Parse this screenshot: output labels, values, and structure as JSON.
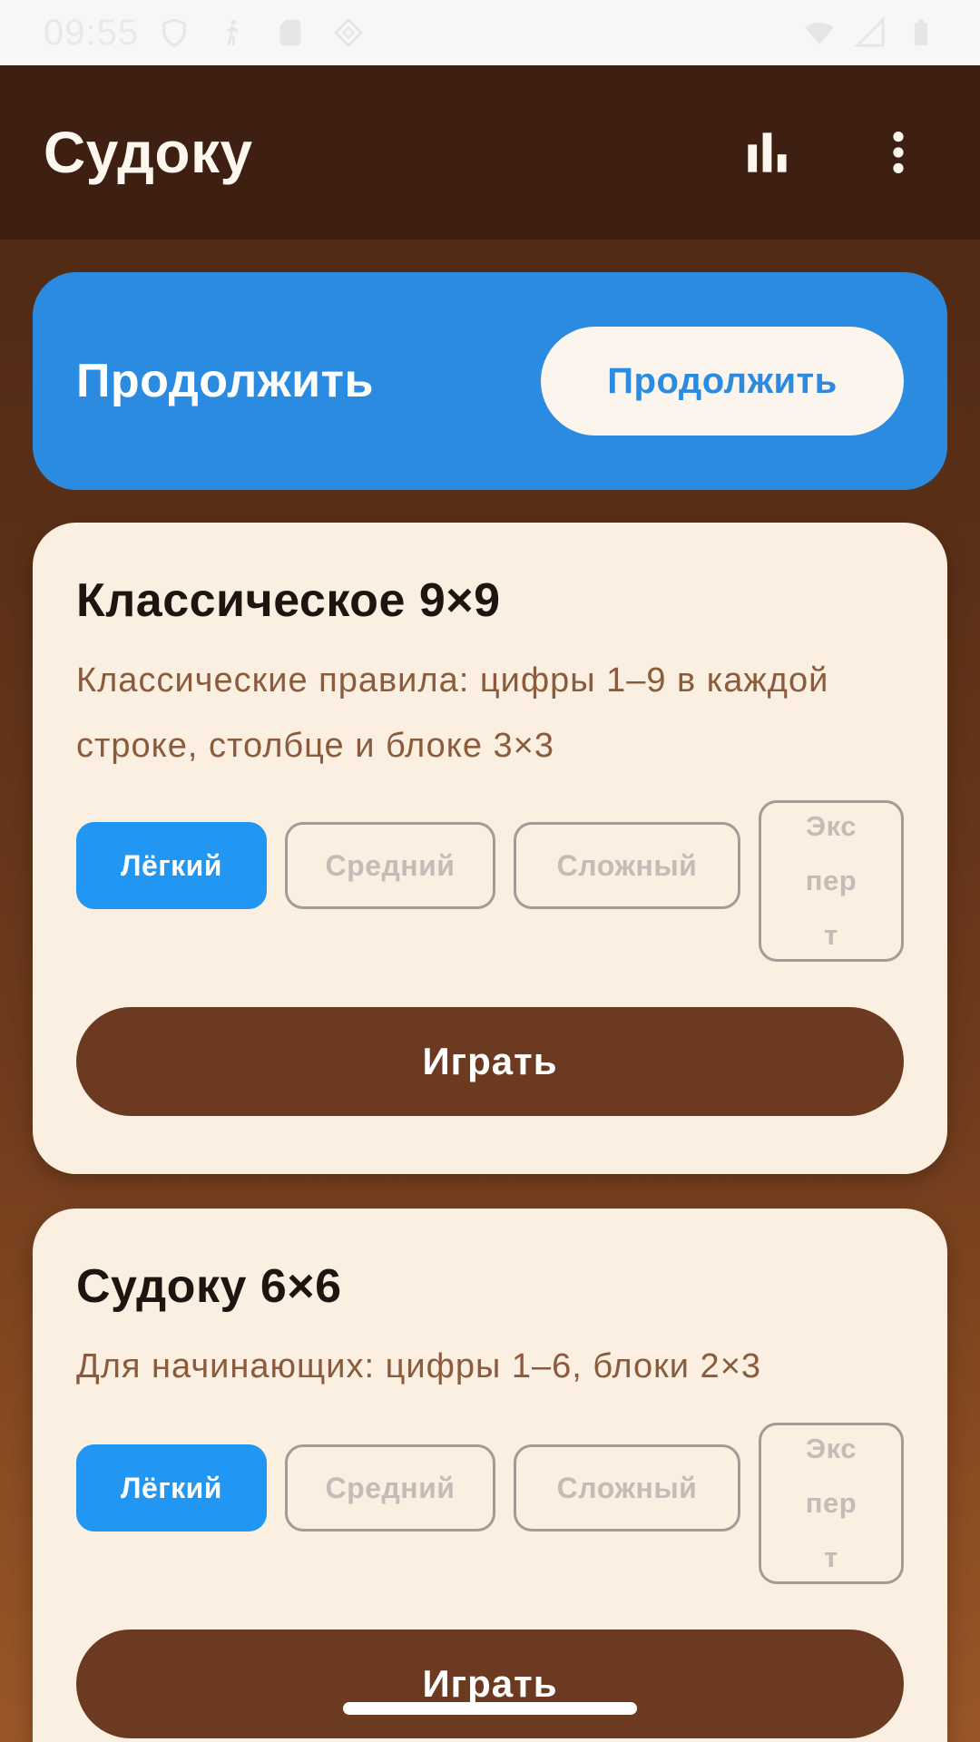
{
  "status_bar": {
    "time": "09:55",
    "left_icons": [
      "shield-icon",
      "walk-icon",
      "sd-card-icon",
      "cast-icon"
    ],
    "right_icons": [
      "wifi-icon",
      "signal-icon",
      "battery-icon"
    ]
  },
  "app_bar": {
    "title": "Судоку",
    "actions": [
      "stats-icon",
      "more-vert-icon"
    ]
  },
  "continue": {
    "title": "Продолжить",
    "button_label": "Продолжить"
  },
  "modes": [
    {
      "title": "Классическое 9×9",
      "description": "Классические правила: цифры 1–9 в каждой строке, столбце и блоке 3×3",
      "difficulties": {
        "easy": "Лёгкий",
        "medium": "Средний",
        "hard": "Сложный",
        "expert_lines": [
          "Экс",
          "пер",
          "т"
        ]
      },
      "selected": "Лёгкий",
      "play_label": "Играть"
    },
    {
      "title": "Судоку 6×6",
      "description": "Для начинающих: цифры 1–6, блоки 2×3",
      "difficulties": {
        "easy": "Лёгкий",
        "medium": "Средний",
        "hard": "Сложный",
        "expert_lines": [
          "Экс",
          "пер",
          "т"
        ]
      },
      "selected": "Лёгкий",
      "play_label": "Играть"
    }
  ],
  "colors": {
    "app_bar": "#3e2012",
    "continue_card": "#2a8be0",
    "card_bg": "#faefe0",
    "selected_chip": "#2196f3",
    "play_button": "#6b3a20"
  }
}
